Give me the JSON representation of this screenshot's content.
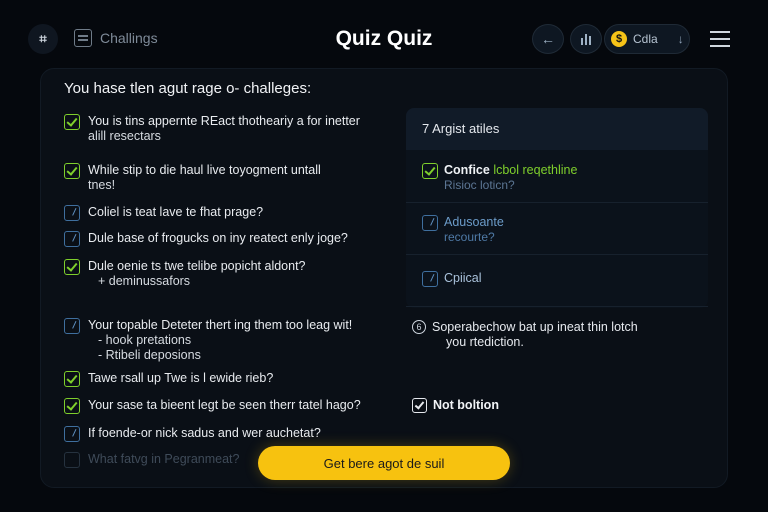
{
  "header": {
    "logo_glyph": "⌗",
    "breadcrumb": "Challings",
    "title": "Quiz Quiz",
    "pill_label": "Cdla",
    "pill_coin": "$"
  },
  "main": {
    "heading": "You hase tlen agut rage o- challeges:",
    "questions": [
      {
        "line1": "You is tins appernte REact thotheariy a for inetter",
        "line2": "alill resectars",
        "state": "checked"
      },
      {
        "line1": "While stip to die haul live toyogment untall",
        "line2": "tnes!",
        "state": "checked"
      },
      {
        "line1": "Coliel is teat lave te fhat prage?",
        "state": "partial"
      },
      {
        "line1": "Dule base of frogucks on iny reatect enly joge?",
        "state": "partial"
      },
      {
        "line1": "Dule oenie ts twe telibe popicht aldont?",
        "line2": "+ deminussafors",
        "state": "checked"
      },
      {
        "line1": "Your topable Deteter thert ing them too leag wit!",
        "line2": "- hook pretations",
        "line3": "- Rtibeli deposions",
        "state": "partial"
      },
      {
        "line1": "Tawe rsall up Twe is l ewide rieb?",
        "state": "checked"
      },
      {
        "line1": "Your sase ta bieent legt be seen therr tatel hago?",
        "state": "checked"
      },
      {
        "line1": "If foende-or nick sadus and wer auchetat?",
        "state": "partial"
      },
      {
        "line1": "What fatvg in Pegranmeat?",
        "state": "dim"
      }
    ]
  },
  "side": {
    "header": "7 Argist atiles",
    "options": [
      {
        "a": "Confice",
        "g": "lcbol reqethline",
        "s": "Risioc loticn?"
      },
      {
        "label": "Adusoante",
        "s": "recourte?"
      },
      {
        "label": "Cpiical"
      }
    ],
    "extra_number": "6",
    "extra_text": "Soperabechow bat up ineat thin lotch",
    "extra_sub": "you rtediction.",
    "not_label": "Not boltion"
  },
  "cta": {
    "label": "Get bere agot de suil"
  },
  "colors": {
    "accent": "#f7c20f",
    "check": "#7fcf2c",
    "panel": "#0a0f16"
  }
}
